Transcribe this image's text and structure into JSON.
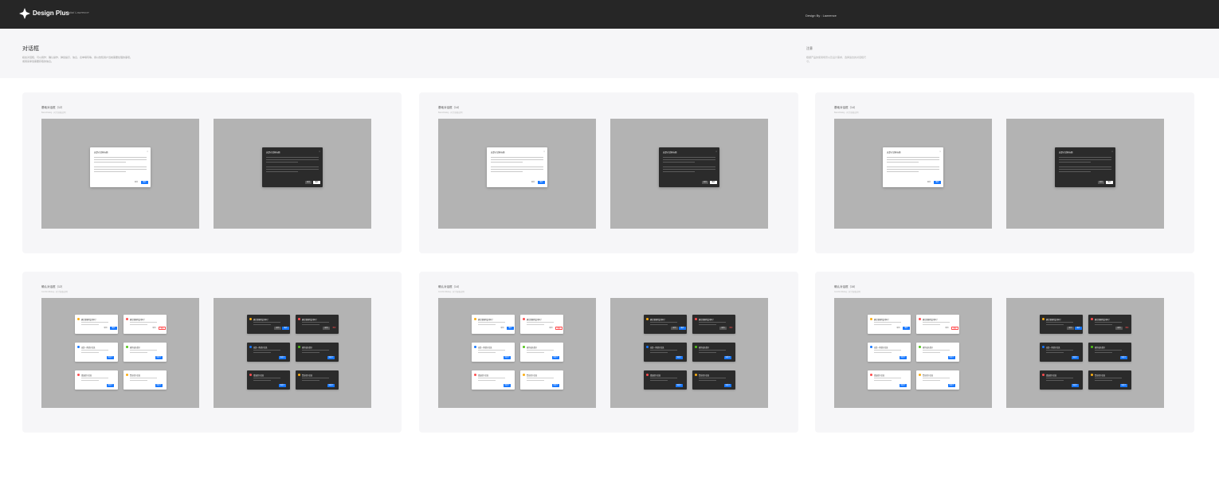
{
  "header": {
    "brand": "Design Plus",
    "brand_tagline": "Digital Lawrence",
    "byline": "Design By : Lawrence"
  },
  "hero": {
    "title": "对话框",
    "description": "模态对话框，可以用作：确认操作、弹窗提示、信息、表单填写等，用以告知用户当前需要处理的事项。",
    "description2": "或用来承载需要获取的信息。",
    "note_title": "注意",
    "note_text": "根据产品的使用场景以及设计需求，选择适合的对话框尺寸。"
  },
  "cards": [
    {
      "title": "基础对话框（12）",
      "sub": "BasicDialog - 尺寸规格说明"
    },
    {
      "title": "基础对话框（14）",
      "sub": "BasicDialog - 尺寸规格说明"
    },
    {
      "title": "基础对话框（14）",
      "sub": "BasicDialog - 尺寸规格说明"
    },
    {
      "title": "确认对话框（12）",
      "sub": "ConfirmDialog - 尺寸规格说明"
    },
    {
      "title": "确认对话框（14）",
      "sub": "ConfirmDialog - 尺寸规格说明"
    },
    {
      "title": "确认对话框（16）",
      "sub": "ConfirmDialog - 尺寸规格说明"
    }
  ],
  "dialog": {
    "title": "这是对话框标题",
    "close": "×",
    "cancel": "取消",
    "ok": "确定"
  },
  "confirm": {
    "items": [
      {
        "title": "确定要删除此项吗？",
        "color": "#faad14",
        "buttons": [
          "取消",
          "确定"
        ]
      },
      {
        "title": "确定要删除此项吗？",
        "color": "#ff4d4f",
        "buttons": [
          "取消",
          "删除"
        ]
      },
      {
        "title": "这是一条提示信息",
        "color": "#1677ff",
        "buttons": [
          "知道了"
        ]
      },
      {
        "title": "操作成功提示",
        "color": "#52c41a",
        "buttons": [
          "知道了"
        ]
      },
      {
        "title": "错误提示信息",
        "color": "#ff4d4f",
        "buttons": [
          "知道了"
        ]
      },
      {
        "title": "警告提示信息",
        "color": "#faad14",
        "buttons": [
          "知道了"
        ]
      }
    ]
  }
}
